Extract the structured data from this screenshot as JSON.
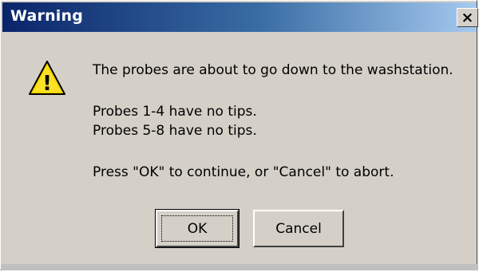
{
  "window": {
    "title": "Warning",
    "close_glyph": "×"
  },
  "icon": {
    "name": "warning-icon",
    "glyph": "!",
    "color": "#f8d800"
  },
  "message": {
    "line1": "The probes are about to go down to the washstation.",
    "line2": "Probes 1-4 have no tips.",
    "line3": "Probes 5-8 have no tips.",
    "line4": "Press \"OK\" to continue, or \"Cancel\" to abort."
  },
  "buttons": {
    "ok_label": "OK",
    "cancel_label": "Cancel"
  },
  "colors": {
    "titlebar_start": "#0a246a",
    "titlebar_end": "#a6caf0",
    "dialog_background": "#d4d0c8"
  }
}
